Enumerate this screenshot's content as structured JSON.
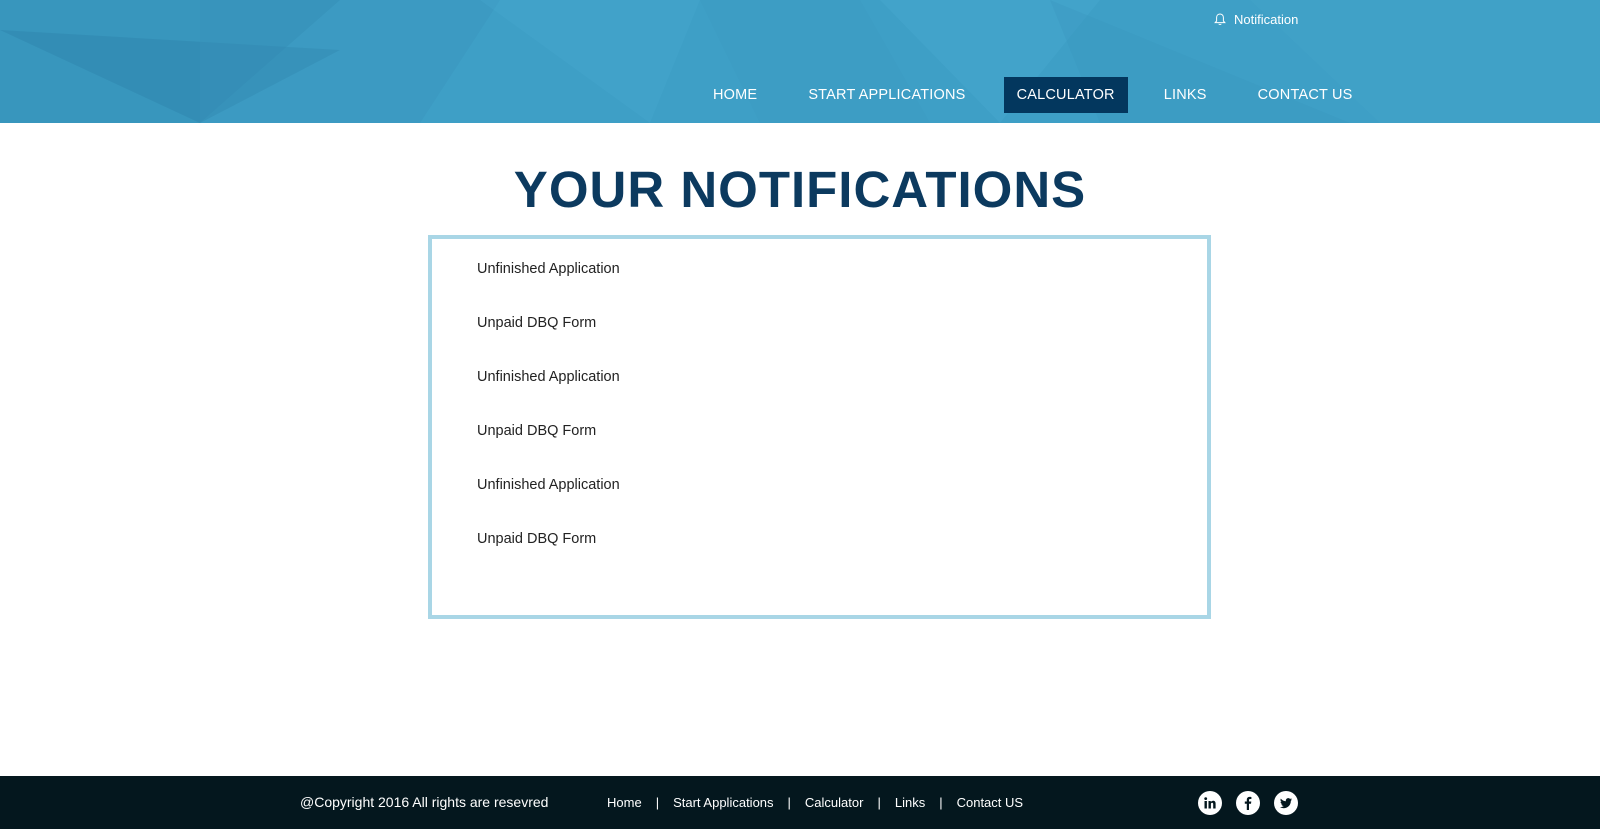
{
  "header": {
    "notification_label": "Notification",
    "nav": {
      "home": "HOME",
      "start": "START APPLICATIONS",
      "calculator": "CALCULATOR",
      "links": "LINKS",
      "contact": "CONTACT US"
    },
    "active_nav": "CALCULATOR",
    "colors": {
      "header_bg": "#3e9fc6",
      "active_bg": "#03375e"
    }
  },
  "main": {
    "title": "YOUR NOTIFICATIONS",
    "notifications": [
      "Unfinished Application",
      "Unpaid DBQ Form",
      "Unfinished Application",
      "Unpaid DBQ Form",
      "Unfinished Application",
      "Unpaid DBQ Form"
    ],
    "colors": {
      "title": "#0c3a5f",
      "box_border": "#a9d6e6"
    }
  },
  "footer": {
    "copyright": "@Copyright 2016 All rights are resevred",
    "links": {
      "home": "Home",
      "start": "Start Applications",
      "calculator": "Calculator",
      "links": "Links",
      "contact": "Contact US"
    },
    "separator": "|",
    "social_icons": [
      "linkedin-icon",
      "facebook-icon",
      "twitter-icon"
    ],
    "colors": {
      "footer_bg": "#04171e"
    }
  }
}
